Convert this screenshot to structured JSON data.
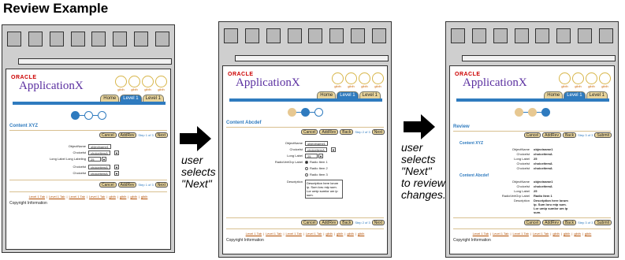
{
  "title": "Review Example",
  "annotation_1": [
    "user",
    "selects",
    "\"Next\""
  ],
  "annotation_2": [
    "user",
    "selects",
    "\"Next\"",
    "to review",
    "changes."
  ],
  "app": {
    "brand": "ORACLE",
    "name": "ApplicationX",
    "global_label": "glblh",
    "tabs": [
      "Home",
      "Level 1",
      "Level 1"
    ],
    "buttons": {
      "cancel": "Cancel",
      "addrev": "AddRev",
      "back": "Back",
      "next": "Next",
      "submit": "Submit"
    },
    "step_1": "Step 1 of 3",
    "step_2": "Step 2 of 3",
    "step_3": "Step 3 of 3",
    "footer_tabs": [
      "Level 1 Tab",
      "Level 1 Tab",
      "Level 1 Tab",
      "Level 1 Tab"
    ],
    "copyright": "Copyright Information"
  },
  "screen1": {
    "heading": "Content XYZ",
    "fields": [
      {
        "label": "ObjectName",
        "value": "objectname1"
      },
      {
        "label": "Choicelst",
        "value": "choiceitemA"
      },
      {
        "label": "Long Label Long Labeling",
        "value": "25"
      },
      {
        "label": "Choicelst",
        "value": "choiceitemA"
      },
      {
        "label": "Choicelst",
        "value": "choiceitemA"
      }
    ]
  },
  "screen2": {
    "heading": "Content Abcdef",
    "fields": [
      {
        "label": "ObjectName",
        "value": "objectname1"
      },
      {
        "label": "Choicelst",
        "value": "choiceitemA"
      },
      {
        "label": "Long Label",
        "value": "25"
      }
    ],
    "radio_label": "RadioVertGrp Label",
    "radios": [
      "Radio Item 1",
      "Radio Item 2",
      "Radio Item 3"
    ],
    "description_label": "Description",
    "description": "Description here lorum ip. Sum loru mip sum. Lor umip sumlor um ip sum."
  },
  "screen3": {
    "heading": "Review",
    "section_1": "Content XYZ",
    "section_1_fields": [
      {
        "label": "ObjectName",
        "value": "objectname1"
      },
      {
        "label": "Choicelst",
        "value": "choiceitemA"
      },
      {
        "label": "Long Label",
        "value": "25"
      },
      {
        "label": "Choicelst",
        "value": "choiceitemA"
      },
      {
        "label": "Choicelst",
        "value": "choiceitemA"
      }
    ],
    "section_2": "Content Abcdef",
    "section_2_fields": [
      {
        "label": "ObjectName",
        "value": "objectname1"
      },
      {
        "label": "Choicelst",
        "value": "choiceitemA"
      },
      {
        "label": "Long Label",
        "value": "25"
      },
      {
        "label": "RadioVertGrp Label",
        "value": "Radio Item 1"
      },
      {
        "label": "Description",
        "value": "Description here lorum ip. Sum loru mip sum. Lor umip sumlor um ip sum."
      }
    ]
  }
}
